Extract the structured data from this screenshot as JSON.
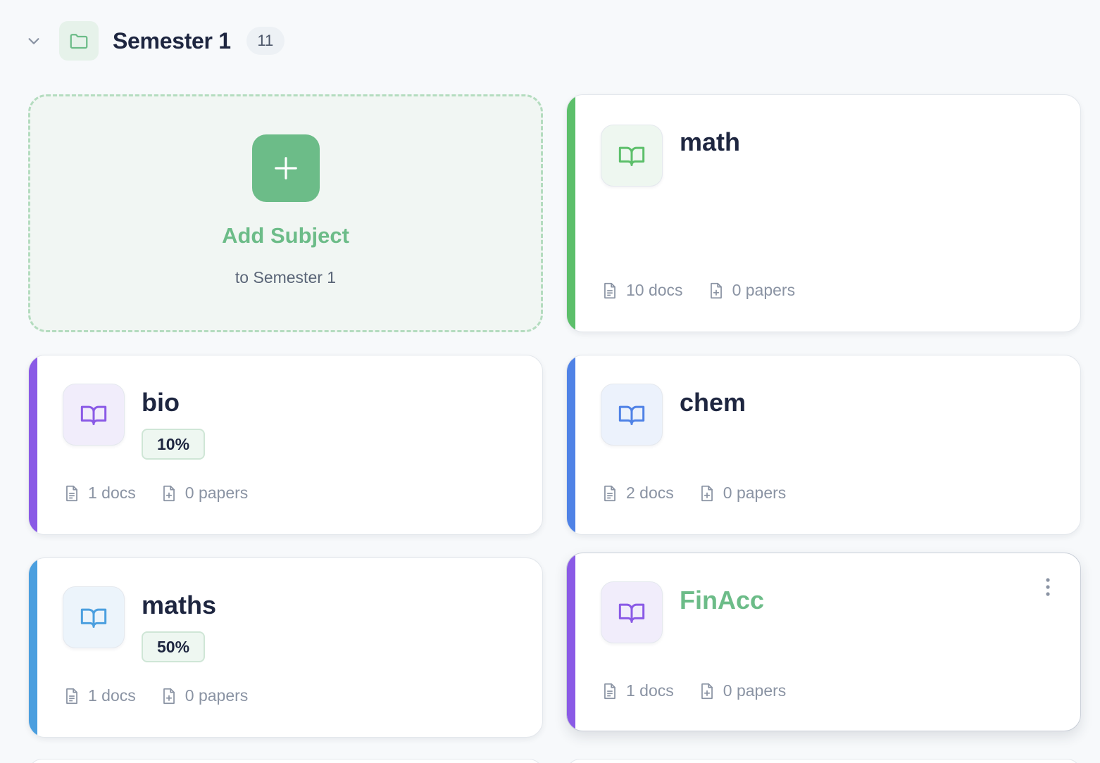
{
  "semester": {
    "title": "Semester 1",
    "count": "11"
  },
  "add_card": {
    "title": "Add Subject",
    "subtitle": "to Semester 1",
    "plus": "+"
  },
  "subjects": [
    {
      "name": "math",
      "docs": "10 docs",
      "papers": "0 papers",
      "progress": null,
      "stripe_color": "#5cbf6a",
      "icon_color": "#5cbf6a",
      "icon_bg": "#eef7f0",
      "name_color": "#1e2640",
      "icon": "book-open-icon"
    },
    {
      "name": "bio",
      "docs": "1 docs",
      "papers": "0 papers",
      "progress": "10%",
      "stripe_color": "#8a5ae6",
      "icon_color": "#8a5ae6",
      "icon_bg": "#f1edfb",
      "name_color": "#1e2640",
      "icon": "book-open-icon"
    },
    {
      "name": "chem",
      "docs": "2 docs",
      "papers": "0 papers",
      "progress": null,
      "stripe_color": "#4f82e6",
      "icon_color": "#4f82e6",
      "icon_bg": "#ecf2fc",
      "name_color": "#1e2640",
      "icon": "book-open-icon"
    },
    {
      "name": "maths",
      "docs": "1 docs",
      "papers": "0 papers",
      "progress": "50%",
      "stripe_color": "#4b9fdf",
      "icon_color": "#4b9fdf",
      "icon_bg": "#ecf4fb",
      "name_color": "#1e2640",
      "icon": "book-open-icon"
    },
    {
      "name": "FinAcc",
      "docs": "1 docs",
      "papers": "0 papers",
      "progress": null,
      "stripe_color": "#8a5ae6",
      "icon_color": "#8a5ae6",
      "icon_bg": "#f1edfb",
      "name_color": "#6cbc88",
      "icon": "book-open-icon"
    }
  ],
  "colors": {
    "accent_green": "#6cbc88",
    "text_dark": "#1e2640",
    "muted": "#8a93a3"
  }
}
